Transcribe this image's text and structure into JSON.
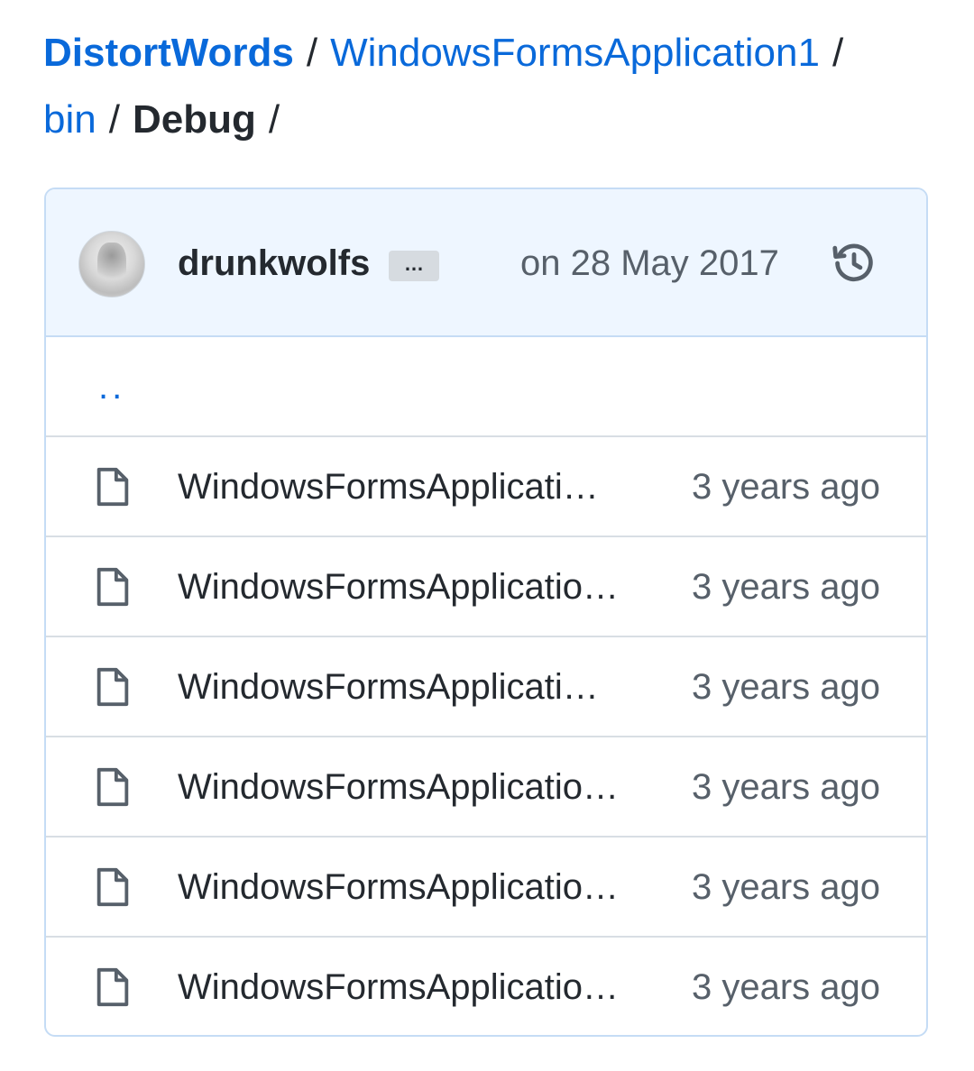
{
  "breadcrumb": {
    "repo": "DistortWords",
    "path": [
      "WindowsFormsApplication1",
      "bin"
    ],
    "current": "Debug",
    "separator": "/"
  },
  "commit": {
    "author": "drunkwolfs",
    "ellipsis": "…",
    "date": "on 28 May 2017",
    "history_icon": "history-icon"
  },
  "parent_link": "..",
  "files": [
    {
      "name": "WindowsFormsApplicati…",
      "age": "3 years ago"
    },
    {
      "name": "WindowsFormsApplicatio…",
      "age": "3 years ago"
    },
    {
      "name": "WindowsFormsApplicati…",
      "age": "3 years ago"
    },
    {
      "name": "WindowsFormsApplicatio…",
      "age": "3 years ago"
    },
    {
      "name": "WindowsFormsApplicatio…",
      "age": "3 years ago"
    },
    {
      "name": "WindowsFormsApplicatio…",
      "age": "3 years ago"
    }
  ],
  "colors": {
    "link": "#0969da",
    "text": "#24292f",
    "muted": "#57606a",
    "header_bg": "#eef6ff"
  }
}
